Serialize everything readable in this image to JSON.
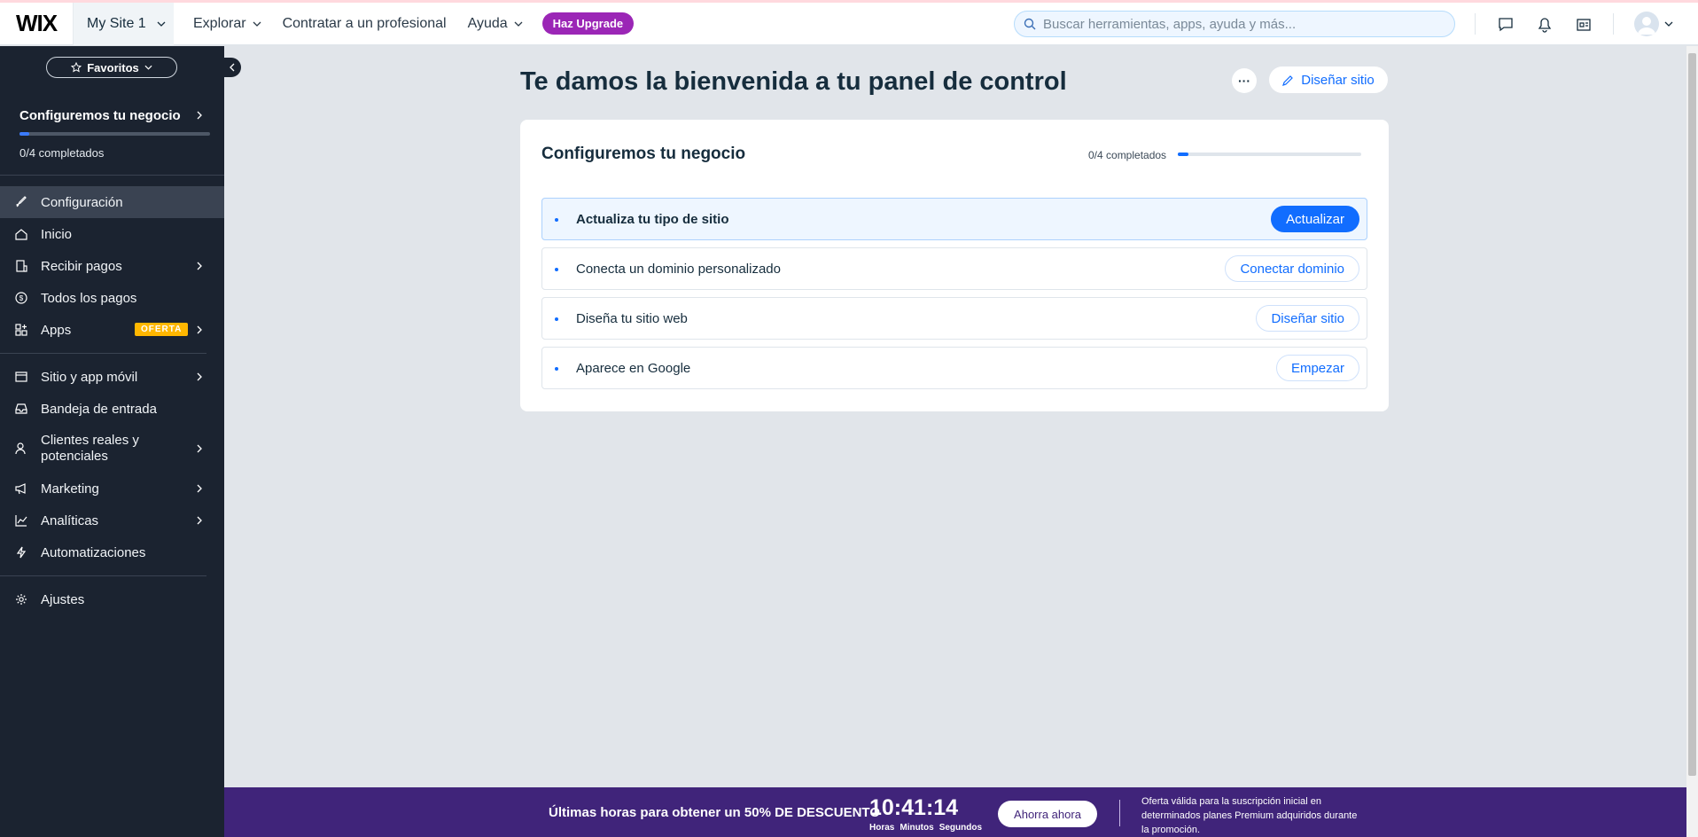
{
  "topbar": {
    "logo": "WIX",
    "site_name": "My Site 1",
    "nav": [
      {
        "label": "Explorar",
        "has_dropdown": true
      },
      {
        "label": "Contratar a un profesional",
        "has_dropdown": false
      },
      {
        "label": "Ayuda",
        "has_dropdown": true
      }
    ],
    "upgrade_label": "Haz Upgrade",
    "search_placeholder": "Buscar herramientas, apps, ayuda y más...",
    "icons": [
      "chat-icon",
      "bell-icon",
      "news-icon",
      "avatar-icon"
    ]
  },
  "sidebar": {
    "favorites_label": "Favoritos",
    "setup": {
      "title": "Configuremos tu negocio",
      "progress_label": "0/4 completados",
      "progress_fraction": 0.05
    },
    "items": [
      {
        "label": "Configuración",
        "icon": "rocket-icon",
        "active": true
      },
      {
        "label": "Inicio",
        "icon": "home-icon"
      },
      {
        "label": "Recibir pagos",
        "icon": "payments-icon",
        "has_children": true
      },
      {
        "label": "Todos los pagos",
        "icon": "dollar-icon"
      },
      {
        "label": "Apps",
        "icon": "apps-icon",
        "badge": "OFERTA",
        "has_children": true
      },
      {
        "label": "Sitio y app móvil",
        "icon": "site-icon",
        "has_children": true
      },
      {
        "label": "Bandeja de entrada",
        "icon": "inbox-icon"
      },
      {
        "label": "Clientes reales y potenciales",
        "icon": "clients-icon",
        "has_children": true
      },
      {
        "label": "Marketing",
        "icon": "megaphone-icon",
        "has_children": true
      },
      {
        "label": "Analíticas",
        "icon": "analytics-icon",
        "has_children": true
      },
      {
        "label": "Automatizaciones",
        "icon": "automation-icon"
      },
      {
        "label": "Ajustes",
        "icon": "gear-icon"
      }
    ]
  },
  "main": {
    "title": "Te damos la bienvenida a tu panel de control",
    "more_label": "···",
    "design_button": "Diseñar sitio",
    "card": {
      "title": "Configuremos tu negocio",
      "progress_label": "0/4 completados",
      "progress_fraction": 0.06,
      "tasks": [
        {
          "label": "Actualiza tu tipo de sitio",
          "button": "Actualizar",
          "active": true
        },
        {
          "label": "Conecta un dominio personalizado",
          "button": "Conectar dominio"
        },
        {
          "label": "Diseña tu sitio web",
          "button": "Diseñar sitio"
        },
        {
          "label": "Aparece en Google",
          "button": "Empezar"
        }
      ]
    }
  },
  "promo": {
    "text": "Últimas horas para obtener un 50% DE DESCUENTO",
    "timer": "10:41:14",
    "timer_labels": [
      "Horas",
      "Minutos",
      "Segundos"
    ],
    "button": "Ahorra ahora",
    "note": "Oferta válida para la suscripción inicial en determinados planes Premium adquiridos durante la promoción."
  },
  "colors": {
    "accent": "#116dff",
    "sidebar_bg": "#1b2330",
    "upgrade": "#9b26b6",
    "promo_bg": "#40247a",
    "badge": "#ffb700"
  }
}
